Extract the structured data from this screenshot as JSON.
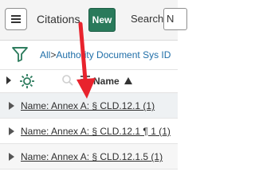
{
  "header": {
    "title": "Citations",
    "new_label": "New",
    "search_label": "Search",
    "search_value": "N"
  },
  "breadcrumb": {
    "all": "All",
    "separator": ">",
    "current": "Authority Document Sys ID"
  },
  "list": {
    "column_name": "Name",
    "sort_direction": "ascending",
    "rows": [
      {
        "label": "Name: Annex A: § CLD.12.1 (1)"
      },
      {
        "label": "Name: Annex A: § CLD.12.1 ¶ 1 (1)"
      },
      {
        "label": "Name: Annex A: § CLD.12.1.5 (1)"
      }
    ]
  },
  "colors": {
    "new_button": "#2a7a5b",
    "annotation_arrow": "#e8232d",
    "link": "#1f6ea8"
  },
  "icons": [
    "hamburger-menu-icon",
    "filter-icon",
    "expand-triangle-icon",
    "gear-icon",
    "search-icon",
    "sort-icon",
    "sort-up-icon",
    "row-expand-icon"
  ]
}
